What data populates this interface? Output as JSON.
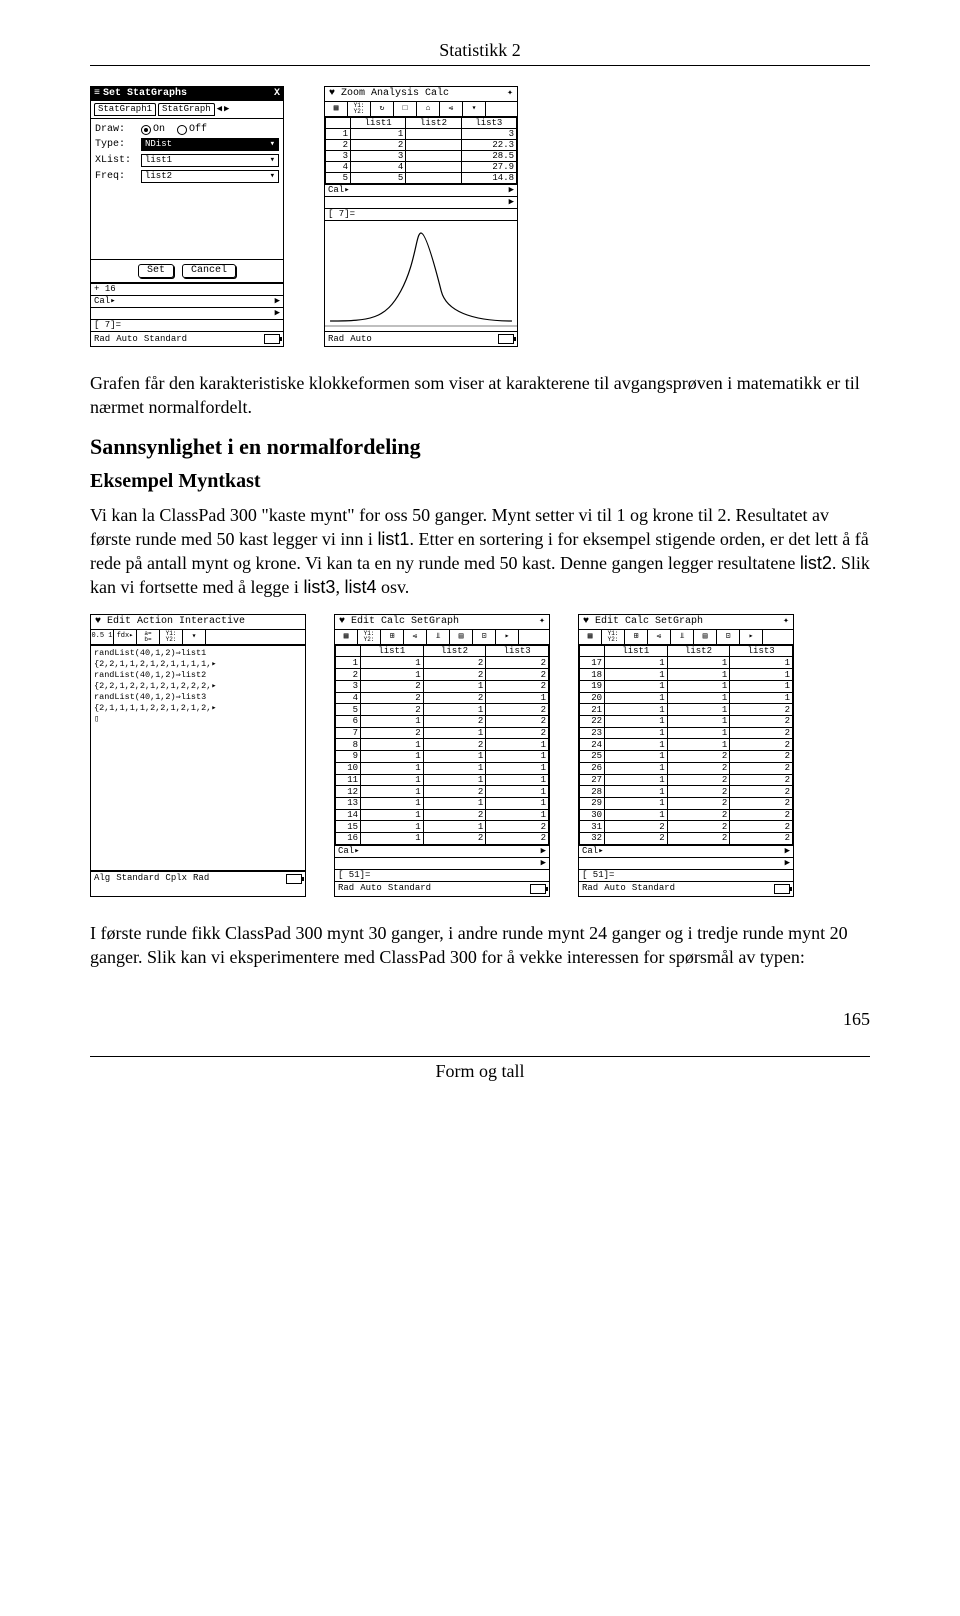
{
  "header": {
    "title": "Statistikk 2"
  },
  "calc1": {
    "title": "Set StatGraphs",
    "close": "X",
    "tabs": [
      "StatGraph1",
      "StatGraph"
    ],
    "arrowL": "◀",
    "arrowR": "▶",
    "rows": {
      "draw": "Draw:",
      "on": "On",
      "off": "Off",
      "type": "Type:",
      "type_val": "NDist",
      "xlist": "XList:",
      "xlist_val": "list1",
      "freq": "Freq:",
      "freq_val": "list2"
    },
    "set": "Set",
    "cancel": "Cancel",
    "plus16": "16",
    "cal": "Cal▸",
    "eq": "[   7]=",
    "status": [
      "Rad",
      "Auto",
      "Standard"
    ]
  },
  "calc2": {
    "menu": [
      "♥",
      "Zoom",
      "Analysis",
      "Calc"
    ],
    "diamond": "✦",
    "icons": [
      "▦",
      "Y1:\nY2:",
      "↻",
      "□",
      "⌂",
      "⩹",
      "▤"
    ],
    "cols": [
      "",
      "list1",
      "list2",
      "list3"
    ],
    "rows": [
      [
        "1",
        "1",
        "",
        "3"
      ],
      [
        "2",
        "2",
        "",
        "22.3"
      ],
      [
        "3",
        "3",
        "",
        "28.5"
      ],
      [
        "4",
        "4",
        "",
        "27.9"
      ],
      [
        "5",
        "5",
        "",
        "14.8"
      ]
    ],
    "cal": "Cal▸",
    "eq": "[   7]=",
    "status": [
      "Rad",
      "Auto"
    ]
  },
  "para1": "Grafen får den karakteristiske klokkeformen som viser at karakterene til avgangsprøven i matematikk er til nærmet normalfordelt.",
  "section1": "Sannsynlighet i en normalfordeling",
  "section2": "Eksempel  Myntkast",
  "para2a": "Vi kan la ClassPad 300 \"kaste mynt\" for oss 50 ganger. Mynt setter vi til 1 og krone til 2. Resultatet av første runde med 50 kast legger vi inn i ",
  "list1": "list1",
  "para2b": ". Etter en sortering i for eksempel stigende orden, er det lett å få rede på antall mynt og krone. Vi kan ta en ny runde med 50 kast. Denne gangen legger resultatene ",
  "list2": "list2",
  "para2c": ". Slik kan vi fortsette med å legge i ",
  "list3": "list3",
  "list4": "list4",
  "osv": " osv.",
  "calc3": {
    "menu": [
      "♥",
      "Edit",
      "Action",
      "Interactive"
    ],
    "iconbar1": [
      "0.5 1",
      "fdx▸",
      "a=\nb=",
      "Y1:\nY2:",
      "▾"
    ],
    "iconbar2": [
      "▸",
      "fdx◊",
      "▸",
      "Y1:\nY2:",
      "▾"
    ],
    "lines": [
      "randList(40,1,2)⇒list1",
      "{2,2,1,1,2,1,2,1,1,1,1,▸",
      "randList(40,1,2)⇒list2",
      "{2,2,1,2,2,1,2,1,2,2,2,▸",
      "randList(40,1,2)⇒list3",
      "{2,1,1,1,1,2,2,1,2,1,2,▸",
      "▯"
    ],
    "status": [
      "Alg",
      "",
      "Standard",
      "Cplx",
      "Rad"
    ]
  },
  "calc4": {
    "menu": [
      "♥",
      "Edit",
      "Calc",
      "SetGraph"
    ],
    "diamond": "✦",
    "icons": [
      "▦",
      "Y1:\nY2:",
      "⊞",
      "⩹",
      "⫫",
      "▤",
      "⊡",
      "▸"
    ],
    "cols": [
      "",
      "list1",
      "list2",
      "list3"
    ],
    "rows": [
      [
        "1",
        "1",
        "2",
        "2"
      ],
      [
        "2",
        "1",
        "2",
        "2"
      ],
      [
        "3",
        "2",
        "1",
        "2"
      ],
      [
        "4",
        "2",
        "2",
        "1"
      ],
      [
        "5",
        "2",
        "1",
        "2"
      ],
      [
        "6",
        "1",
        "2",
        "2"
      ],
      [
        "7",
        "2",
        "1",
        "2"
      ],
      [
        "8",
        "1",
        "2",
        "1"
      ],
      [
        "9",
        "1",
        "1",
        "1"
      ],
      [
        "10",
        "1",
        "1",
        "1"
      ],
      [
        "11",
        "1",
        "1",
        "1"
      ],
      [
        "12",
        "1",
        "2",
        "1"
      ],
      [
        "13",
        "1",
        "1",
        "1"
      ],
      [
        "14",
        "1",
        "2",
        "1"
      ],
      [
        "15",
        "1",
        "1",
        "2"
      ],
      [
        "16",
        "1",
        "2",
        "2"
      ]
    ],
    "cal": "Cal▸",
    "eq": "[   51]=",
    "status": [
      "Rad",
      "Auto",
      "Standard"
    ]
  },
  "calc5": {
    "menu": [
      "♥",
      "Edit",
      "Calc",
      "SetGraph"
    ],
    "diamond": "✦",
    "icons": [
      "▦",
      "Y1:\nY2:",
      "⊞",
      "⩹",
      "⫫",
      "▤",
      "⊡",
      "▸"
    ],
    "cols": [
      "",
      "list1",
      "list2",
      "list3"
    ],
    "rows": [
      [
        "17",
        "1",
        "1",
        "1"
      ],
      [
        "18",
        "1",
        "1",
        "1"
      ],
      [
        "19",
        "1",
        "1",
        "1"
      ],
      [
        "20",
        "1",
        "1",
        "1"
      ],
      [
        "21",
        "1",
        "1",
        "2"
      ],
      [
        "22",
        "1",
        "1",
        "2"
      ],
      [
        "23",
        "1",
        "1",
        "2"
      ],
      [
        "24",
        "1",
        "1",
        "2"
      ],
      [
        "25",
        "1",
        "2",
        "2"
      ],
      [
        "26",
        "1",
        "2",
        "2"
      ],
      [
        "27",
        "1",
        "2",
        "2"
      ],
      [
        "28",
        "1",
        "2",
        "2"
      ],
      [
        "29",
        "1",
        "2",
        "2"
      ],
      [
        "30",
        "1",
        "2",
        "2"
      ],
      [
        "31",
        "2",
        "2",
        "2"
      ],
      [
        "32",
        "2",
        "2",
        "2"
      ]
    ],
    "cal": "Cal▸",
    "eq": "[   51]=",
    "status": [
      "Rad",
      "Auto",
      "Standard"
    ]
  },
  "para3": "I første runde fikk ClassPad 300 mynt 30 ganger, i andre runde mynt 24 ganger og i tredje runde mynt 20 ganger. Slik kan vi eksperimentere med ClassPad 300 for å vekke interessen for spørsmål av typen:",
  "footer": {
    "center": "Form og tall",
    "page": "165"
  }
}
